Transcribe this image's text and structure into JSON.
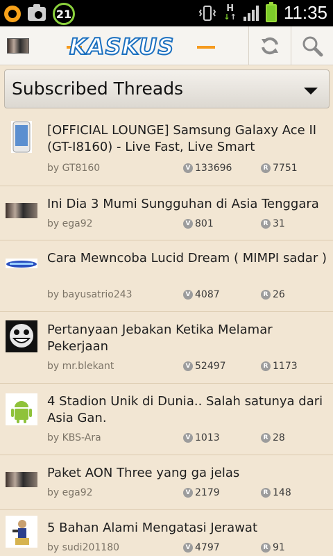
{
  "status_bar": {
    "notification_count": "21",
    "network_type": "H",
    "time": "11:35"
  },
  "action_bar": {
    "logo_text": "KASKUS",
    "icons": [
      "refresh-icon",
      "search-icon"
    ]
  },
  "dropdown": {
    "selected": "Subscribed Threads"
  },
  "threads": [
    {
      "title": "[OFFICIAL LOUNGE] Samsung Galaxy Ace II (GT-I8160) - Live Fast, Live Smart",
      "author": "by GT8160",
      "views": "133696",
      "replies": "7751",
      "thumb": "phone-thumbnail"
    },
    {
      "title": "Ini Dia 3 Mumi Sungguhan di Asia Tenggara",
      "author": "by ega92",
      "views": "801",
      "replies": "31",
      "thumb": "user-avatar"
    },
    {
      "title": "Cara Mewncoba Lucid Dream ( MIMPI sadar )",
      "author": "by bayusatrio243",
      "views": "4087",
      "replies": "26",
      "thumb": "lucid-dream-thumbnail"
    },
    {
      "title": "Pertanyaan Jebakan Ketika Melamar Pekerjaan",
      "author": "by mr.blekant",
      "views": "52497",
      "replies": "1173",
      "thumb": "troll-face-thumbnail"
    },
    {
      "title": "4 Stadion Unik di Dunia.. Salah satunya dari Asia Gan.",
      "author": "by KBS-Ara",
      "views": "1013",
      "replies": "28",
      "thumb": "android-thumbnail"
    },
    {
      "title": "Paket AON Three yang ga jelas",
      "author": "by ega92",
      "views": "2179",
      "replies": "148",
      "thumb": "user-avatar"
    },
    {
      "title": "5 Bahan Alami Mengatasi Jerawat",
      "author": "by sudi201180",
      "views": "4797",
      "replies": "91",
      "thumb": "character-thumbnail"
    }
  ],
  "labels": {
    "views_badge": "V",
    "replies_badge": "R"
  },
  "colors": {
    "background": "#f2e6d3",
    "logo_blue": "#1a6fbf",
    "logo_orange": "#f59a1e"
  }
}
